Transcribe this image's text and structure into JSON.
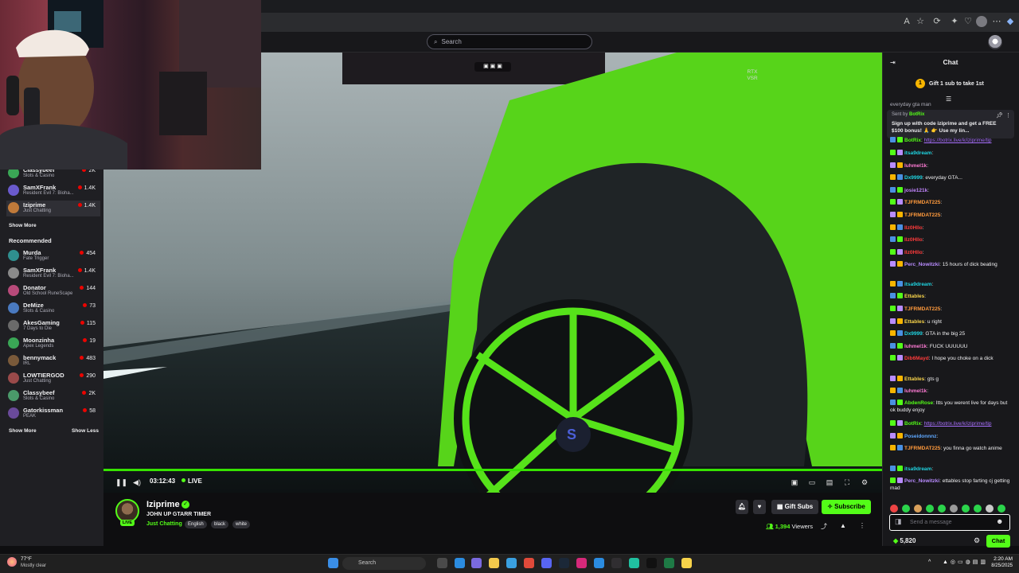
{
  "browser": {
    "icons": [
      "translate-icon",
      "bookmark-star-icon",
      "extensions-icon",
      "extensions-2-icon",
      "favorites-icon",
      "profile-icon",
      "menu-icon",
      "copilot-icon"
    ]
  },
  "header": {
    "search_placeholder": "Search"
  },
  "sidebar": {
    "followed": [
      {
        "name": "Classybeef",
        "game": "Slots & Casino",
        "viewers": "2K"
      },
      {
        "name": "SamXFrank",
        "game": "Resident Evil 7: Bioha...",
        "viewers": "1.4K"
      },
      {
        "name": "Iziprime",
        "game": "Just Chatting",
        "viewers": "1.4K"
      }
    ],
    "show_more_1": "Show More",
    "recommended_heading": "Recommended",
    "recommended": [
      {
        "name": "Murda",
        "game": "Fate Trigger",
        "viewers": "454"
      },
      {
        "name": "SamXFrank",
        "game": "Resident Evil 7: Bioha...",
        "viewers": "1.4K"
      },
      {
        "name": "Donator",
        "game": "Old School RuneScape",
        "viewers": "144"
      },
      {
        "name": "DeMize",
        "game": "Slots & Casino",
        "viewers": "73"
      },
      {
        "name": "AkesGaming",
        "game": "7 Days to Die",
        "viewers": "115"
      },
      {
        "name": "Moonzinha",
        "game": "Apex Legends",
        "viewers": "19"
      },
      {
        "name": "bennymack",
        "game": "IRL",
        "viewers": "483"
      },
      {
        "name": "LOWTIERGOD",
        "game": "Just Chatting",
        "viewers": "290"
      },
      {
        "name": "Classybeef",
        "game": "Slots & Casino",
        "viewers": "2K"
      },
      {
        "name": "Gatorkissman",
        "game": "PEAK",
        "viewers": "58"
      }
    ],
    "show_more_2": "Show More",
    "show_less": "Show Less"
  },
  "video": {
    "watermark": "RTX VSR",
    "elapsed": "03:12:43",
    "live_label": "LIVE",
    "progress": 1.0
  },
  "stream": {
    "streamer": "Iziprime",
    "live_badge": "LIVE",
    "title": "JOHN UP GTARR TIMER",
    "category": "Just Chatting",
    "tags": [
      "English",
      "black",
      "white"
    ],
    "gift_subs_label": "Gift Subs",
    "subscribe_label": "Subscribe",
    "viewers_count": "1,394",
    "viewers_label": "Viewers"
  },
  "chat": {
    "title": "Chat",
    "gift_banner": "Gift 1 sub to take 1st",
    "gift_count": "1",
    "top_fragment": "everyday gta man",
    "pinned_sender": "Sent by",
    "pinned_user": "BotRix",
    "pinned_text": "Sign up with code iziprime and get a FREE $100 bonus! 🙏 👉 Use my lin...",
    "messages": [
      {
        "user": "BotRix",
        "color": "#53fc18",
        "text": "https://botrix.live/k/iziprime/tip",
        "link": true
      },
      {
        "user": "itsa9dream",
        "color": "#1fd3e0",
        "text": ""
      },
      {
        "user": "luhmel1k",
        "color": "#ff7bd5",
        "text": ""
      },
      {
        "user": "Dx9999",
        "color": "#1fd3e0",
        "text": "everyday GTA..."
      },
      {
        "user": "josie121k",
        "color": "#c084fc",
        "text": ""
      },
      {
        "user": "TJFRMDAT225",
        "color": "#ff9a3c",
        "text": ""
      },
      {
        "user": "TJFRMDAT225",
        "color": "#ff9a3c",
        "text": ""
      },
      {
        "user": "Ilz0Hllo",
        "color": "#ff3b3b",
        "text": ""
      },
      {
        "user": "Ilz0Hllo",
        "color": "#ff3b3b",
        "text": ""
      },
      {
        "user": "Ilz0Hllo",
        "color": "#ff3b3b",
        "text": ""
      },
      {
        "user": "Perc_Nowitzki",
        "color": "#b98cff",
        "text": "15 hours of dick beating"
      },
      {
        "user": "itsa9dream",
        "color": "#1fd3e0",
        "text": ""
      },
      {
        "user": "Ettables",
        "color": "#f7d34a",
        "text": ""
      },
      {
        "user": "TJFRMDAT225",
        "color": "#ff9a3c",
        "text": ""
      },
      {
        "user": "Ettables",
        "color": "#f7d34a",
        "text": "u right"
      },
      {
        "user": "Dx9999",
        "color": "#1fd3e0",
        "text": "GTA in the big 25"
      },
      {
        "user": "luhmel1k",
        "color": "#ff7bd5",
        "text": "FUCK UUUUUU"
      },
      {
        "user": "Dib6Mayd",
        "color": "#ff3b3b",
        "text": "I hope you choke on a dick"
      },
      {
        "user": "Ettables",
        "color": "#f7d34a",
        "text": "gts g"
      },
      {
        "user": "luhmel1k",
        "color": "#ff7bd5",
        "text": ""
      },
      {
        "user": "AbdenRose",
        "color": "#53fc18",
        "text": "Itts you werent live for days but ok buddy enjoy"
      },
      {
        "user": "BotRix",
        "color": "#53fc18",
        "text": "https://botrix.live/k/iziprime/tip",
        "link": true
      },
      {
        "user": "Poseidonnnz",
        "color": "#5fa8ff",
        "text": ""
      },
      {
        "user": "TJFRMDAT225",
        "color": "#ff9a3c",
        "text": "you finna go watch anime"
      },
      {
        "user": "itsa9dream",
        "color": "#1fd3e0",
        "text": ""
      },
      {
        "user": "Perc_Nowitzki",
        "color": "#b98cff",
        "text": "ettables stop farting cj getting mad"
      }
    ],
    "input_placeholder": "Send a message",
    "points": "5,820",
    "send_label": "Chat"
  },
  "taskbar": {
    "temperature": "77°F",
    "weather": "Mostly clear",
    "search_placeholder": "Search",
    "time": "2:20 AM",
    "date": "8/25/2025"
  },
  "colors": {
    "accent": "#53fc18",
    "live_dot": "#eb0400",
    "background": "#0e0e10",
    "sidebar": "#1f1f23"
  }
}
